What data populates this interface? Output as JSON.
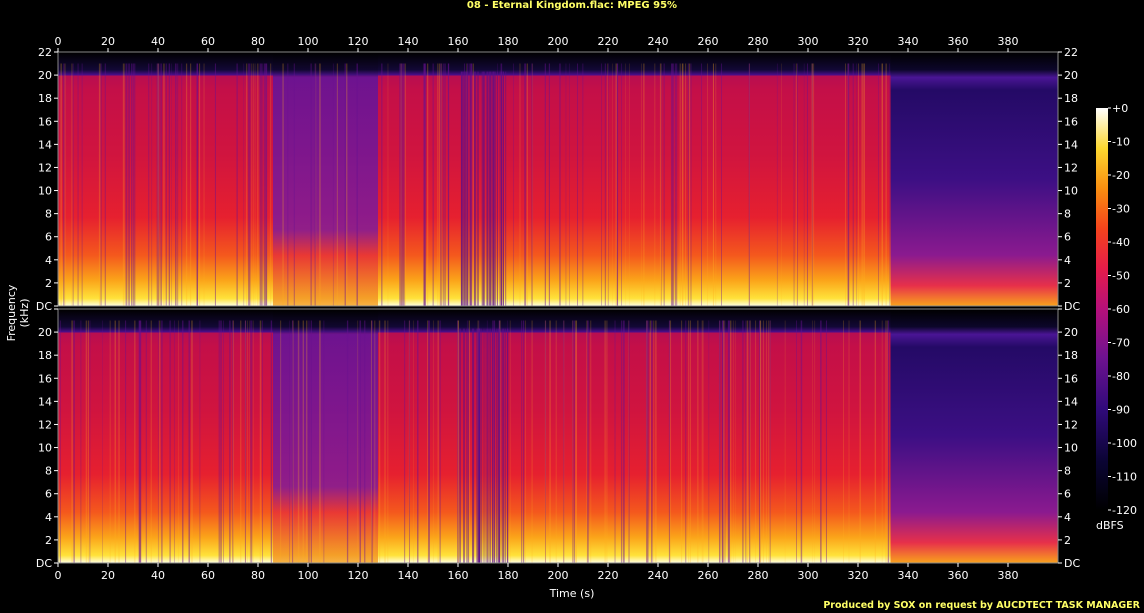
{
  "chart_data": {
    "type": "heatmap",
    "title": "08 - Eternal Kingdom.flac: MPEG 95%",
    "xlabel": "Time (s)",
    "ylabel": "Frequency (kHz)",
    "xlim": [
      0,
      400
    ],
    "ylim": [
      0,
      22
    ],
    "x_ticks": [
      0,
      20,
      40,
      60,
      80,
      100,
      120,
      140,
      160,
      180,
      200,
      220,
      240,
      260,
      280,
      300,
      320,
      340,
      360,
      380
    ],
    "y_tick_labels": [
      "DC",
      "2",
      "4",
      "6",
      "8",
      "10",
      "12",
      "14",
      "16",
      "18",
      "20",
      "22"
    ],
    "channels": 2,
    "colorbar": {
      "unit": "dBFS",
      "range": [
        -120,
        0
      ],
      "tick_labels": [
        "+0",
        "-10",
        "-20",
        "-30",
        "-40",
        "-50",
        "-60",
        "-70",
        "-80",
        "-90",
        "-100",
        "-110",
        "-120"
      ]
    },
    "lowpass_cutoff_khz": 20,
    "audio_end_s": 333
  },
  "footer": "Produced by SOX on request by AUCDTECT TASK MANAGER"
}
